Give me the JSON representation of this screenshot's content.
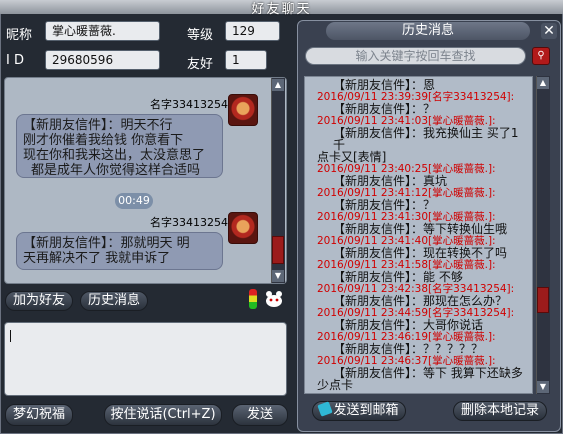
{
  "window": {
    "title": "好友聊天"
  },
  "profile": {
    "nickname_label": "昵称",
    "nickname_value": "掌心暖蔷薇.",
    "level_label": "等级",
    "level_value": "129",
    "id_label": "I D",
    "id_value": "29680596",
    "friendship_label": "友好",
    "friendship_value": "1"
  },
  "chat": {
    "messages": [
      {
        "sender": "名字33413254",
        "lines": [
          "【新朋友信件】：明天不行",
          "刚才你催着我给钱 你意看下",
          "现在你和我来这出，太没意思了",
          "都是成年人你觉得这样合适吗"
        ]
      },
      {
        "sender": "名字33413254",
        "lines": [
          "【新朋友信件】：那就明天  明",
          "天再解决不了 我就申诉了"
        ]
      }
    ],
    "time_divider": "00:49"
  },
  "actions": {
    "add_friend": "加为好友",
    "history": "历史消息"
  },
  "input": {
    "value": ""
  },
  "bottom": {
    "wish": "梦幻祝福",
    "send_hint": "按住说话(Ctrl+Z)",
    "send": "发送"
  },
  "history": {
    "title": "历史消息",
    "search_placeholder": "输入关键字按回车查找",
    "entries": [
      {
        "head": "【新朋友信件】：恩",
        "time": "",
        "msg": ""
      },
      {
        "head": "",
        "time": "2016/09/11 23:39:39[名字33413254]:",
        "msg": ""
      },
      {
        "head": "【新朋友信件】：？",
        "time": "",
        "msg": ""
      },
      {
        "head": "",
        "time": "2016/09/11 23:41:03[掌心暖蔷薇.]:",
        "msg": ""
      },
      {
        "head": "【新朋友信件】：我充换仙主 买了1千",
        "time": "",
        "msg": "点卡又[表情]"
      },
      {
        "head": "",
        "time": "2016/09/11 23:40:25[掌心暖蔷薇.]:",
        "msg": ""
      },
      {
        "head": "【新朋友信件】：真坑",
        "time": "",
        "msg": ""
      },
      {
        "head": "",
        "time": "2016/09/11 23:41:12[掌心暖蔷薇.]:",
        "msg": ""
      },
      {
        "head": "【新朋友信件】：？",
        "time": "",
        "msg": ""
      },
      {
        "head": "",
        "time": "2016/09/11 23:41:30[掌心暖蔷薇.]:",
        "msg": ""
      },
      {
        "head": "【新朋友信件】：等下转换仙生哦",
        "time": "",
        "msg": ""
      },
      {
        "head": "",
        "time": "2016/09/11 23:41:40[掌心暖蔷薇.]:",
        "msg": ""
      },
      {
        "head": "【新朋友信件】：现在转换不了吗",
        "time": "",
        "msg": ""
      },
      {
        "head": "",
        "time": "2016/09/11 23:41:58[掌心暖蔷薇.]:",
        "msg": ""
      },
      {
        "head": "【新朋友信件】：能 不够",
        "time": "",
        "msg": ""
      },
      {
        "head": "",
        "time": "2016/09/11 23:42:38[名字33413254]:",
        "msg": ""
      },
      {
        "head": "【新朋友信件】：那现在怎么办？",
        "time": "",
        "msg": ""
      },
      {
        "head": "",
        "time": "2016/09/11 23:44:59[名字33413254]:",
        "msg": ""
      },
      {
        "head": "【新朋友信件】：大哥你说话",
        "time": "",
        "msg": ""
      },
      {
        "head": "",
        "time": "2016/09/11 23:46:19[掌心暖蔷薇.]:",
        "msg": ""
      },
      {
        "head": "【新朋友信件】：？？？？？",
        "time": "",
        "msg": ""
      },
      {
        "head": "",
        "time": "2016/09/11 23:46:37[掌心暖蔷薇.]:",
        "msg": ""
      },
      {
        "head": "【新朋友信件】：等下 我算下还缺多",
        "time": "",
        "msg": "少点卡"
      }
    ],
    "send_mail": "发送到邮箱",
    "delete_local": "删除本地记录"
  }
}
